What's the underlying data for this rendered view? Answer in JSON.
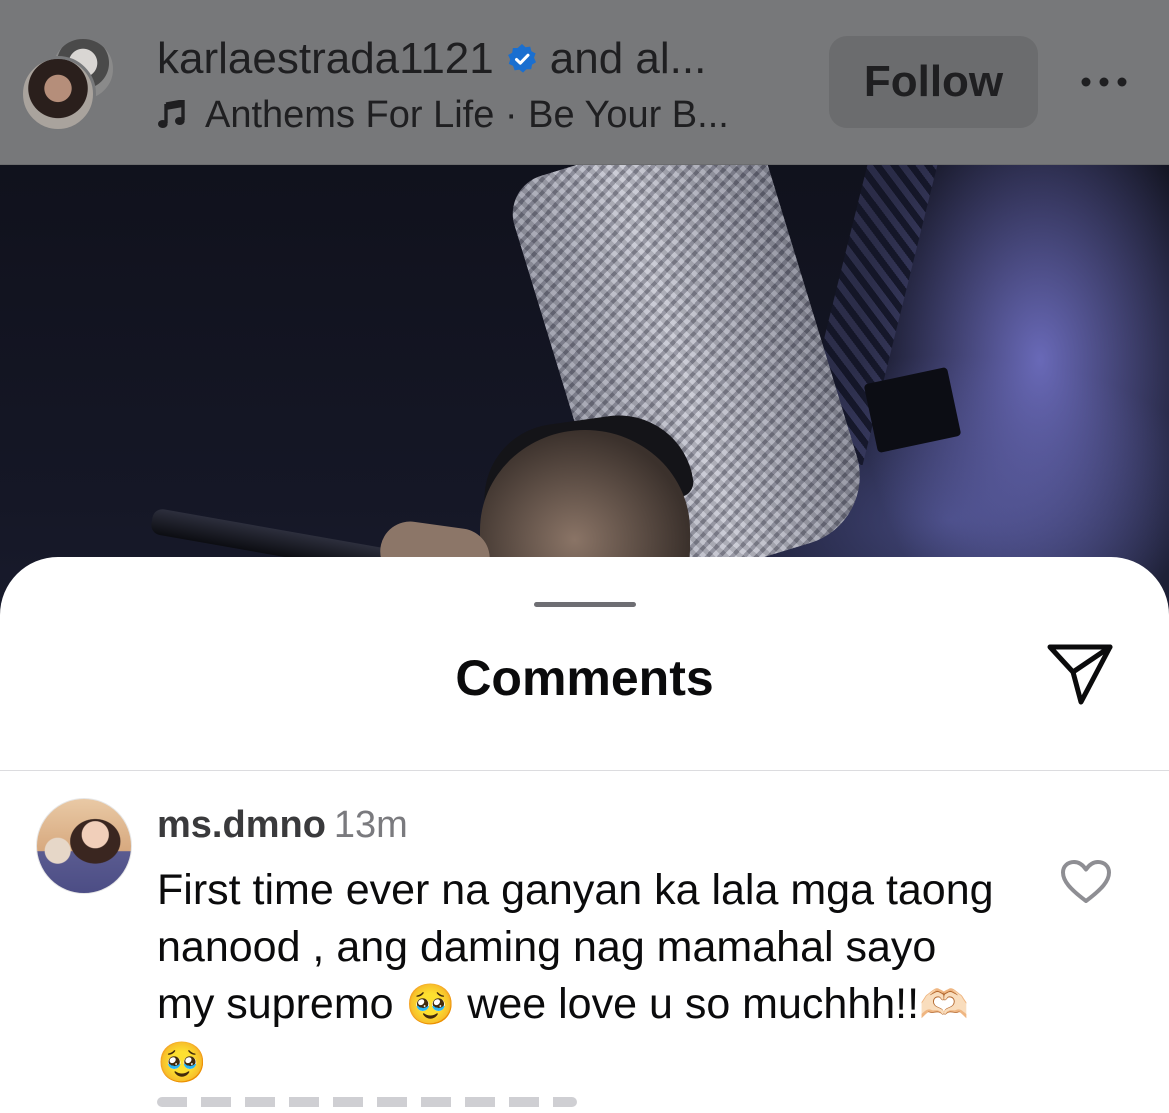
{
  "header": {
    "title_user": "karlaestrada1121",
    "title_suffix": "and al...",
    "audio_label": "Anthems For Life · Be Your B...",
    "follow_label": "Follow",
    "verified_color": "#1877f2"
  },
  "sheet": {
    "title": "Comments"
  },
  "comment": {
    "username": "ms.dmno",
    "time": "13m",
    "text_part1": "First time ever na ganyan ka lala mga taong nanood , ang daming nag mamahal sayo my supremo",
    "emoji1": "🥹",
    "text_part2": "wee love u so muchhh!!",
    "emoji2": "🫶🏻",
    "emoji3": "🥹"
  },
  "icons": {
    "verified": "verified-badge-icon",
    "music": "music-note-icon",
    "more": "more-options-icon",
    "share": "send-icon",
    "like": "heart-icon"
  }
}
